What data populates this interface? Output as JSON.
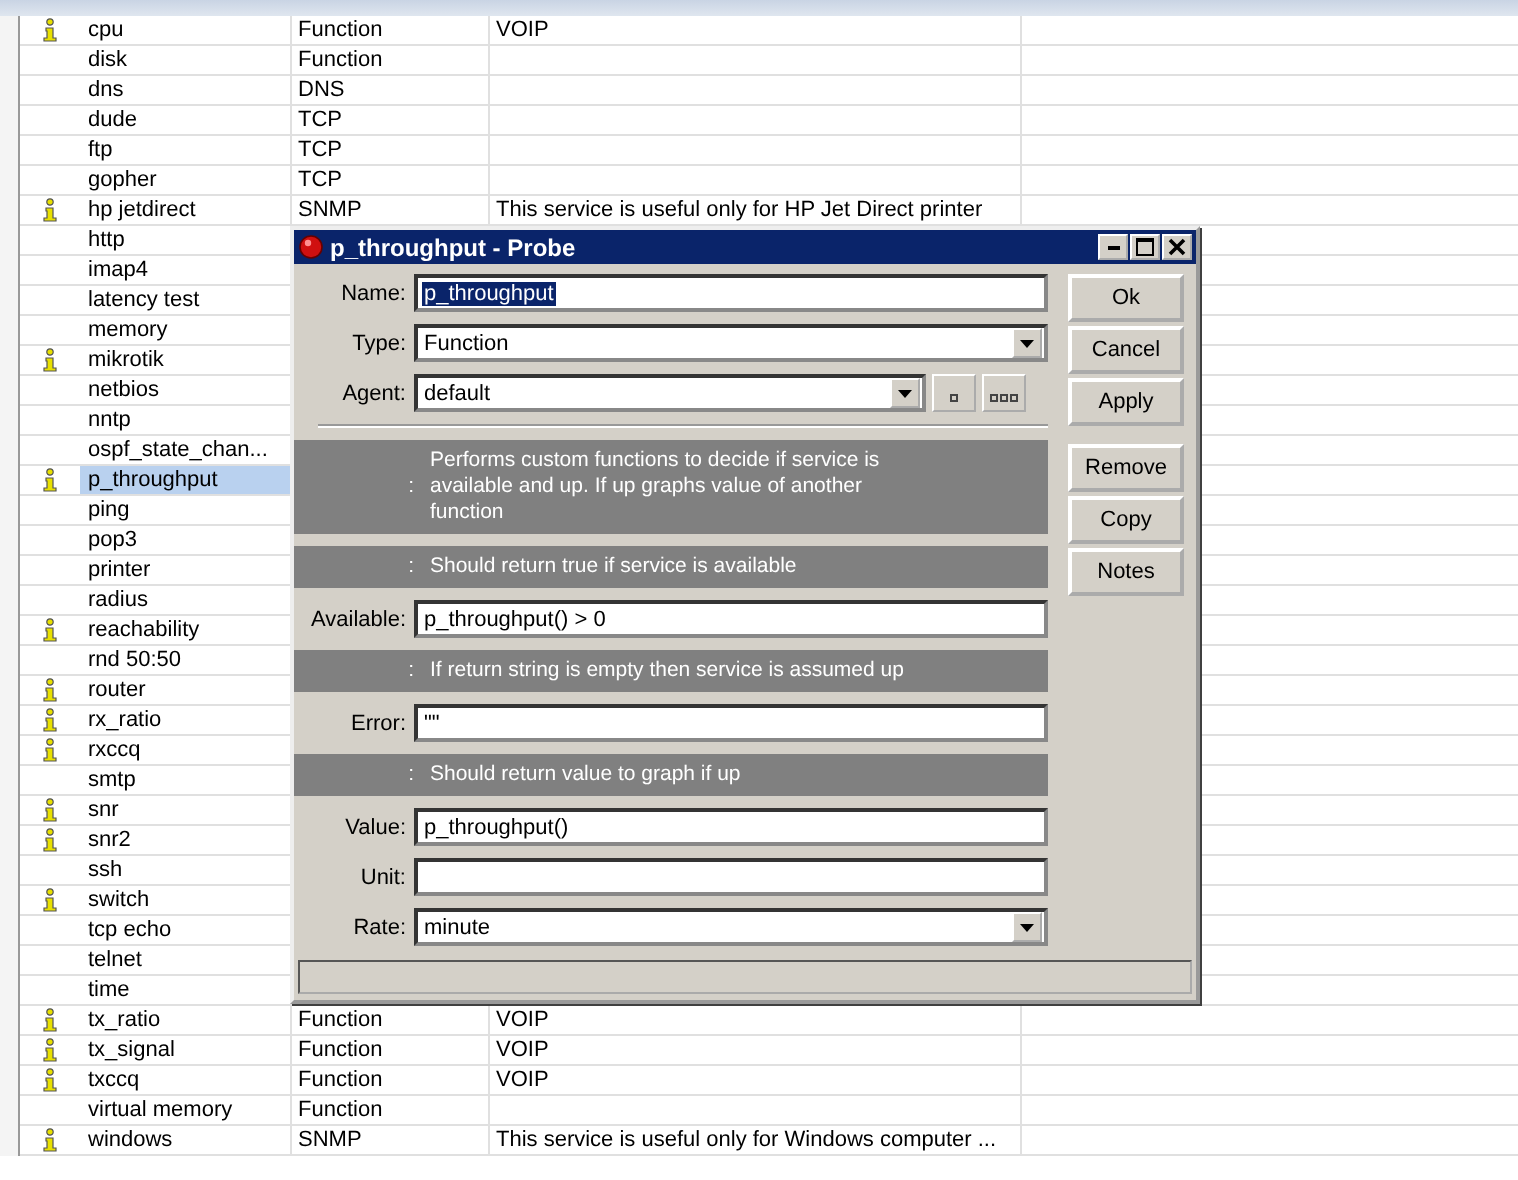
{
  "services": [
    {
      "info": true,
      "name": "cpu",
      "type": "Function",
      "description": "VOIP",
      "selected": false
    },
    {
      "info": false,
      "name": "disk",
      "type": "Function",
      "selected": false
    },
    {
      "info": false,
      "name": "dns",
      "type": "DNS",
      "selected": false
    },
    {
      "info": false,
      "name": "dude",
      "type": "TCP",
      "selected": false
    },
    {
      "info": false,
      "name": "ftp",
      "type": "TCP",
      "selected": false
    },
    {
      "info": false,
      "name": "gopher",
      "type": "TCP",
      "selected": false
    },
    {
      "info": true,
      "name": "hp jetdirect",
      "type": "SNMP",
      "description": "This service is useful only for HP Jet Direct printer",
      "selected": false
    },
    {
      "info": false,
      "name": "http",
      "selected": false
    },
    {
      "info": false,
      "name": "imap4",
      "selected": false
    },
    {
      "info": false,
      "name": "latency test",
      "selected": false
    },
    {
      "info": false,
      "name": "memory",
      "selected": false
    },
    {
      "info": true,
      "name": "mikrotik",
      "selected": false
    },
    {
      "info": false,
      "name": "netbios",
      "selected": false
    },
    {
      "info": false,
      "name": "nntp",
      "selected": false
    },
    {
      "info": false,
      "name": "ospf_state_chan...",
      "selected": false
    },
    {
      "info": true,
      "name": "p_throughput",
      "selected": true
    },
    {
      "info": false,
      "name": "ping",
      "selected": false
    },
    {
      "info": false,
      "name": "pop3",
      "selected": false
    },
    {
      "info": false,
      "name": "printer",
      "selected": false
    },
    {
      "info": false,
      "name": "radius",
      "selected": false
    },
    {
      "info": true,
      "name": "reachability",
      "selected": false
    },
    {
      "info": false,
      "name": "rnd 50:50",
      "selected": false
    },
    {
      "info": true,
      "name": "router",
      "selected": false
    },
    {
      "info": true,
      "name": "rx_ratio",
      "selected": false
    },
    {
      "info": true,
      "name": "rxccq",
      "selected": false
    },
    {
      "info": false,
      "name": "smtp",
      "selected": false
    },
    {
      "info": true,
      "name": "snr",
      "selected": false
    },
    {
      "info": true,
      "name": "snr2",
      "selected": false
    },
    {
      "info": false,
      "name": "ssh",
      "selected": false
    },
    {
      "info": true,
      "name": "switch",
      "selected": false
    },
    {
      "info": false,
      "name": "tcp echo",
      "selected": false
    },
    {
      "info": false,
      "name": "telnet",
      "selected": false
    },
    {
      "info": false,
      "name": "time",
      "selected": false
    },
    {
      "info": true,
      "name": "tx_ratio",
      "type": "Function",
      "description": "VOIP",
      "selected": false
    },
    {
      "info": true,
      "name": "tx_signal",
      "type": "Function",
      "description": "VOIP",
      "selected": false
    },
    {
      "info": true,
      "name": "txccq",
      "type": "Function",
      "description": "VOIP",
      "selected": false
    },
    {
      "info": false,
      "name": "virtual memory",
      "type": "Function",
      "selected": false
    },
    {
      "info": true,
      "name": "windows",
      "type": "SNMP",
      "description": "This service is useful only for Windows computer ...",
      "selected": false
    }
  ],
  "dialog": {
    "title": "p_throughput - Probe",
    "rows": [
      {
        "kind": "text",
        "label": "Name:",
        "value": "p_throughput",
        "highlighted": true
      },
      {
        "kind": "dropdown",
        "label": "Type:",
        "value": "Function"
      },
      {
        "kind": "agent",
        "label": "Agent:",
        "value": "default"
      },
      {
        "kind": "separator"
      },
      {
        "kind": "hint",
        "label": ":",
        "text": "Performs custom functions to decide if service is available and up. If up graphs value of another function"
      },
      {
        "kind": "hint",
        "label": ":",
        "text": "Should return true if service is available"
      },
      {
        "kind": "text",
        "label": "Available:",
        "value": "p_throughput() > 0"
      },
      {
        "kind": "hint",
        "label": ":",
        "text": "If return string is empty then service is assumed up"
      },
      {
        "kind": "text",
        "label": "Error:",
        "value": "\"\""
      },
      {
        "kind": "hint",
        "label": ":",
        "text": "Should return value to graph if up"
      },
      {
        "kind": "text",
        "label": "Value:",
        "value": "p_throughput()"
      },
      {
        "kind": "text",
        "label": "Unit:",
        "value": ""
      },
      {
        "kind": "dropdown",
        "label": "Rate:",
        "value": "minute"
      }
    ],
    "buttons": [
      "Ok",
      "Cancel",
      "Apply",
      "Remove",
      "Copy",
      "Notes"
    ]
  }
}
